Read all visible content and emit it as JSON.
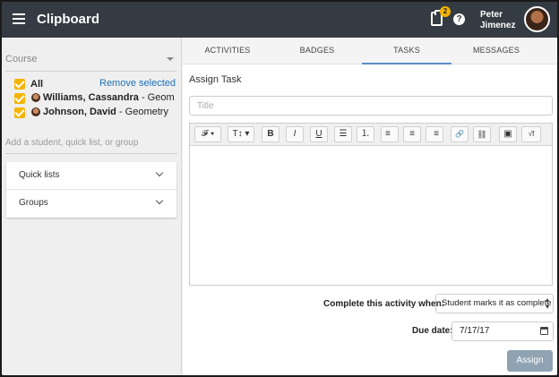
{
  "app": {
    "title": "Clipboard",
    "notification_count": "2",
    "user_name_first": "Peter",
    "user_name_last": "Jimenez"
  },
  "sidebar": {
    "course_placeholder": "Course",
    "all_label": "All",
    "remove_selected": "Remove selected",
    "students": [
      {
        "name": "Williams, Cassandra",
        "course": " - Geometry"
      },
      {
        "name": "Johnson, David",
        "course": " - Geometry"
      }
    ],
    "add_placeholder": "Add a student, quick list, or group",
    "accordions": [
      {
        "label": "Quick lists"
      },
      {
        "label": "Groups"
      }
    ]
  },
  "tabs": [
    {
      "label": "ACTIVITIES",
      "active": false
    },
    {
      "label": "BADGES",
      "active": false
    },
    {
      "label": "TASKS",
      "active": true
    },
    {
      "label": "MESSAGES",
      "active": false
    }
  ],
  "task_form": {
    "section_title": "Assign Task",
    "title_placeholder": "Title",
    "toolbar": [
      {
        "icon": "font-family-icon",
        "glyph": "𝓕 ▾"
      },
      {
        "icon": "text-size-icon",
        "glyph": "T↕ ▾"
      },
      {
        "icon": "bold-icon",
        "glyph": "B"
      },
      {
        "icon": "italic-icon",
        "glyph": "I"
      },
      {
        "icon": "underline-icon",
        "glyph": "U"
      },
      {
        "icon": "bullet-list-icon",
        "glyph": "☰"
      },
      {
        "icon": "numbered-list-icon",
        "glyph": "⒈"
      },
      {
        "icon": "align-left-icon",
        "glyph": "≡"
      },
      {
        "icon": "align-center-icon",
        "glyph": "≡"
      },
      {
        "icon": "align-right-icon",
        "glyph": "≡"
      },
      {
        "icon": "link-icon",
        "glyph": "🔗"
      },
      {
        "icon": "unlink-icon",
        "glyph": "⛓"
      },
      {
        "icon": "image-icon",
        "glyph": "▣"
      },
      {
        "icon": "formula-icon",
        "glyph": "√f"
      }
    ],
    "complete_label": "Complete this activity when:",
    "complete_value": "Student marks it as complete",
    "due_label": "Due date:",
    "due_value": "7/17/17",
    "assign_label": "Assign"
  },
  "colors": {
    "topbar": "#353b42",
    "checkbox": "#f5b400",
    "link": "#1e6fb8",
    "assign_button": "#8fa3b3",
    "active_tab_underline": "#5b8fc7"
  }
}
